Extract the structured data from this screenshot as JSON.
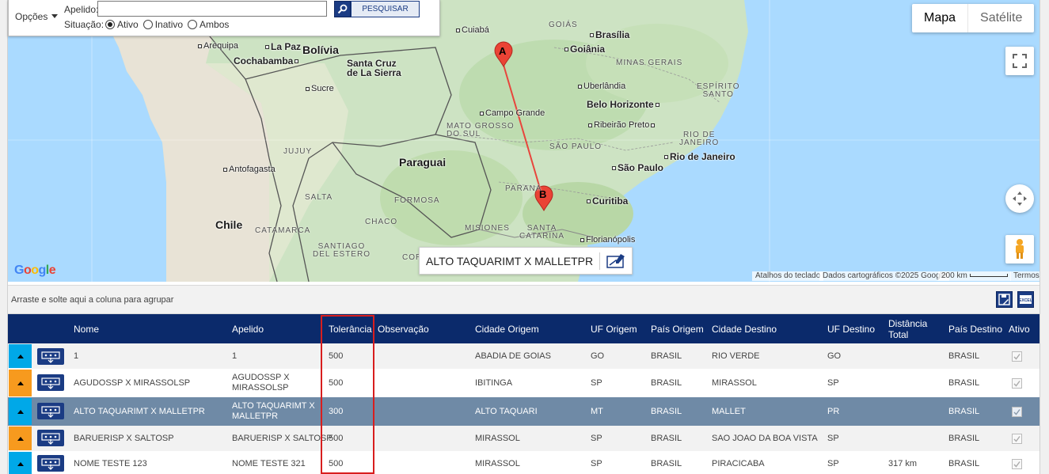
{
  "filter": {
    "opcoes_label": "Opções",
    "apelido_label": "Apelido:",
    "apelido_value": "",
    "search_label": "PESQUISAR",
    "situacao_label": "Situação:",
    "radios": [
      {
        "label": "Ativo",
        "checked": true
      },
      {
        "label": "Inativo",
        "checked": false
      },
      {
        "label": "Ambos",
        "checked": false
      }
    ]
  },
  "map": {
    "type_buttons": [
      "Mapa",
      "Satélite"
    ],
    "route_label": "ALTO TAQUARIMT X MALLETPR",
    "marker_a": "A",
    "marker_b": "B",
    "google": "Google",
    "attribution": {
      "keyboard": "Atalhos do teclado",
      "data": "Dados cartográficos ©2025 Google",
      "scale": "200 km",
      "terms": "Termos"
    },
    "labels": {
      "bolivia": "Bolívia",
      "paraguai": "Paraguai",
      "chile": "Chile",
      "la_paz": "La Paz",
      "cochabamba": "Cochabamba",
      "santa_cruz": "Santa Cruz\nde La Sierra",
      "arequipa": "Arequipa",
      "sucre": "Sucre",
      "antofagasta": "Antofagasta",
      "cuiaba": "Cuiabá",
      "goias": "GOIÁS",
      "brasilia": "Brasília",
      "goiania": "Goiânia",
      "minas_gerais": "MINAS GERAIS",
      "uberlandia": "Uberlândia",
      "espirito_santo": "ESPÍRITO\nSANTO",
      "belo_horizonte": "Belo Horizonte",
      "campo_grande": "Campo Grande",
      "mato_grosso_sul": "MATO GROSSO\nDO SUL",
      "ribeirao_preto": "Ribeirão Preto",
      "rio_de_janeiro_state": "RIO DE\nJANEIRO",
      "rio_de_janeiro": "Rio de Janeiro",
      "sao_paulo_state": "SÃO PAULO",
      "sao_paulo": "São Paulo",
      "parana": "PARANÁ",
      "curitiba": "Curitiba",
      "santa_catarina": "SANTA\nCATARINA",
      "florianopolis": "Florianópolis",
      "misiones": "MISIONES",
      "formosa": "FORMOSA",
      "chaco": "CHACO",
      "salta": "SALTA",
      "jujuy": "JUJUY",
      "catamarca": "CATAMARCA",
      "santiago_estero": "SANTIAGO\nDEL ESTERO",
      "corrientes": "COR"
    }
  },
  "grid": {
    "group_hint": "Arraste e solte aqui a coluna para agrupar",
    "columns": [
      "Nome",
      "Apelido",
      "Tolerância",
      "Observação",
      "Cidade Origem",
      "UF Origem",
      "País Origem",
      "Cidade Destino",
      "UF Destino",
      "Distância\nTotal",
      "País Destino",
      "Ativo"
    ],
    "rows": [
      {
        "nome": "1",
        "apelido": "1",
        "tolerancia": "500",
        "observacao": "",
        "cidade_origem": "ABADIA DE GOIAS",
        "uf_origem": "GO",
        "pais_origem": "BRASIL",
        "cidade_destino": "RIO VERDE",
        "uf_destino": "GO",
        "distancia": "",
        "pais_destino": "BRASIL"
      },
      {
        "nome": "AGUDOSSP X MIRASSOLSP",
        "apelido": "AGUDOSSP X\nMIRASSOLSP",
        "tolerancia": "500",
        "observacao": "",
        "cidade_origem": "IBITINGA",
        "uf_origem": "SP",
        "pais_origem": "BRASIL",
        "cidade_destino": "MIRASSOL",
        "uf_destino": "SP",
        "distancia": "",
        "pais_destino": "BRASIL"
      },
      {
        "nome": "ALTO TAQUARIMT X MALLETPR",
        "apelido": "ALTO TAQUARIMT X\nMALLETPR",
        "tolerancia": "300",
        "observacao": "",
        "cidade_origem": "ALTO TAQUARI",
        "uf_origem": "MT",
        "pais_origem": "BRASIL",
        "cidade_destino": "MALLET",
        "uf_destino": "PR",
        "distancia": "",
        "pais_destino": "BRASIL"
      },
      {
        "nome": "BARUERISP X SALTOSP",
        "apelido": "BARUERISP X SALTOSP",
        "tolerancia": "500",
        "observacao": "",
        "cidade_origem": "MIRASSOL",
        "uf_origem": "SP",
        "pais_origem": "BRASIL",
        "cidade_destino": "SAO JOAO DA BOA VISTA",
        "uf_destino": "SP",
        "distancia": "",
        "pais_destino": "BRASIL"
      },
      {
        "nome": "NOME TESTE 123",
        "apelido": "NOME TESTE 321",
        "tolerancia": "500",
        "observacao": "",
        "cidade_origem": "MIRASSOL",
        "uf_origem": "SP",
        "pais_origem": "BRASIL",
        "cidade_destino": "PIRACICABA",
        "uf_destino": "SP",
        "distancia": "317 km",
        "pais_destino": "BRASIL"
      }
    ]
  },
  "colors": {
    "header": "#0b2a6b",
    "selected_row": "#6f8aa6",
    "expander_blue": "#00a8e8",
    "expander_orange": "#f79a1e",
    "highlight": "#d81e1e",
    "route": "#e8453c"
  }
}
